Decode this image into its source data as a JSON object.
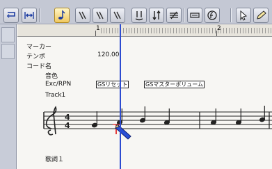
{
  "ruler": {
    "marks": [
      "1",
      "2"
    ]
  },
  "tracks": {
    "marker_label": "マーカー",
    "tempo_label": "テンポ",
    "tempo_value": "120.00",
    "chord_label": "コード名",
    "tone_label": "音色",
    "exc_label": "Exc/RPN",
    "gs_reset": "GSリセット",
    "gs_master_volume": "GSマスターボリューム",
    "track_name": "Track1",
    "time_sig_top": "4",
    "time_sig_bottom": "4",
    "lyrics_label": "歌詞１"
  },
  "colors": {
    "cursor": "#2c4bd0",
    "accent": "#f0c860",
    "toolbar": "#c4c8d4"
  },
  "icons": [
    "loop-left-icon",
    "fit-width-icon",
    "note-tool-icon",
    "rest-a-icon",
    "rest-b-icon",
    "rest-c-icon",
    "tie-icon",
    "updown-icon",
    "slur-icon",
    "text-box-icon",
    "dynamics-icon",
    "pointer-icon",
    "pencil-icon"
  ]
}
